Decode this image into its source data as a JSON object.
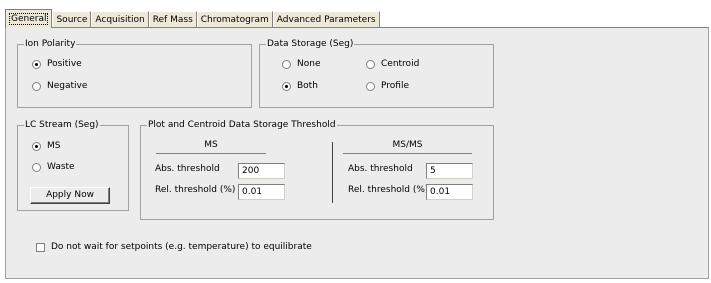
{
  "tabs": [
    "General",
    "Source",
    "Acquisition",
    "Ref Mass",
    "Chromatogram",
    "Advanced Parameters"
  ],
  "ion_polarity": {
    "title": "Ion Polarity",
    "options": [
      {
        "label": "Positive",
        "selected": true
      },
      {
        "label": "Negative",
        "selected": false
      }
    ]
  },
  "data_storage": {
    "title": "Data Storage (Seg)",
    "options": [
      {
        "label": "None",
        "selected": false
      },
      {
        "label": "Centroid",
        "selected": false
      },
      {
        "label": "Both",
        "selected": true
      },
      {
        "label": "Profile",
        "selected": false
      }
    ]
  },
  "lc_stream": {
    "title": "LC Stream (Seg)",
    "options": [
      {
        "label": "MS",
        "selected": true
      },
      {
        "label": "Waste",
        "selected": false
      }
    ],
    "apply_label": "Apply Now"
  },
  "threshold": {
    "title": "Plot and Centroid Data Storage Threshold",
    "ms": {
      "header": "MS",
      "abs_label": "Abs. threshold",
      "abs_value": "200",
      "rel_label": "Rel. threshold (%)",
      "rel_value": "0.01"
    },
    "msms": {
      "header": "MS/MS",
      "abs_label": "Abs. threshold",
      "abs_value": "5",
      "rel_label": "Rel. threshold (%)",
      "rel_value": "0.01"
    }
  },
  "wait_checkbox": {
    "label": "Do not wait for setpoints (e.g. temperature) to equilibrate",
    "checked": false
  }
}
